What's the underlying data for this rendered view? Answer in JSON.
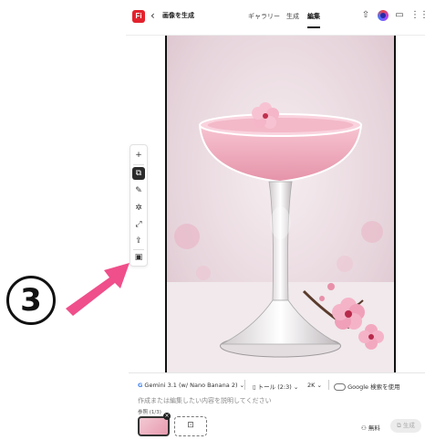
{
  "header": {
    "logo_text": "Fi",
    "back_icon": "chevron-left-icon",
    "title": "画像を生成",
    "tabs": [
      {
        "label": "ギャラリー"
      },
      {
        "label": "生成"
      },
      {
        "label": "編集",
        "active": true
      }
    ],
    "icons": [
      "upload-icon",
      "avatar",
      "comment-icon",
      "apps-grid-icon"
    ]
  },
  "toolbar": {
    "items": [
      {
        "icon": "plus-icon",
        "glyph": "+"
      },
      {
        "icon": "generate-image-icon",
        "glyph": "⧉",
        "active": true
      },
      {
        "icon": "edit-image-icon",
        "glyph": "✎"
      },
      {
        "icon": "remove-background-icon",
        "glyph": "✲"
      },
      {
        "icon": "expand-image-icon",
        "glyph": "⤢"
      },
      {
        "icon": "upscale-icon",
        "glyph": "⇪"
      },
      {
        "icon": "reference-image-icon",
        "glyph": "▣"
      }
    ]
  },
  "annotation": {
    "label": "③",
    "color": "#ef4f8a"
  },
  "prompt": {
    "model": "Gemini 3.1 (w/ Nano Banana 2)",
    "aspect": "トール (2:3)",
    "resolution": "2K",
    "google_search": "Google 検索を使用",
    "placeholder": "作成または編集したい内容を説明してください",
    "reference_label": "参照 (1/3)",
    "credit": "無料",
    "generate_label": "生成"
  },
  "colors": {
    "brand": "#e3222d",
    "accent_arrow": "#ef4f8a"
  }
}
